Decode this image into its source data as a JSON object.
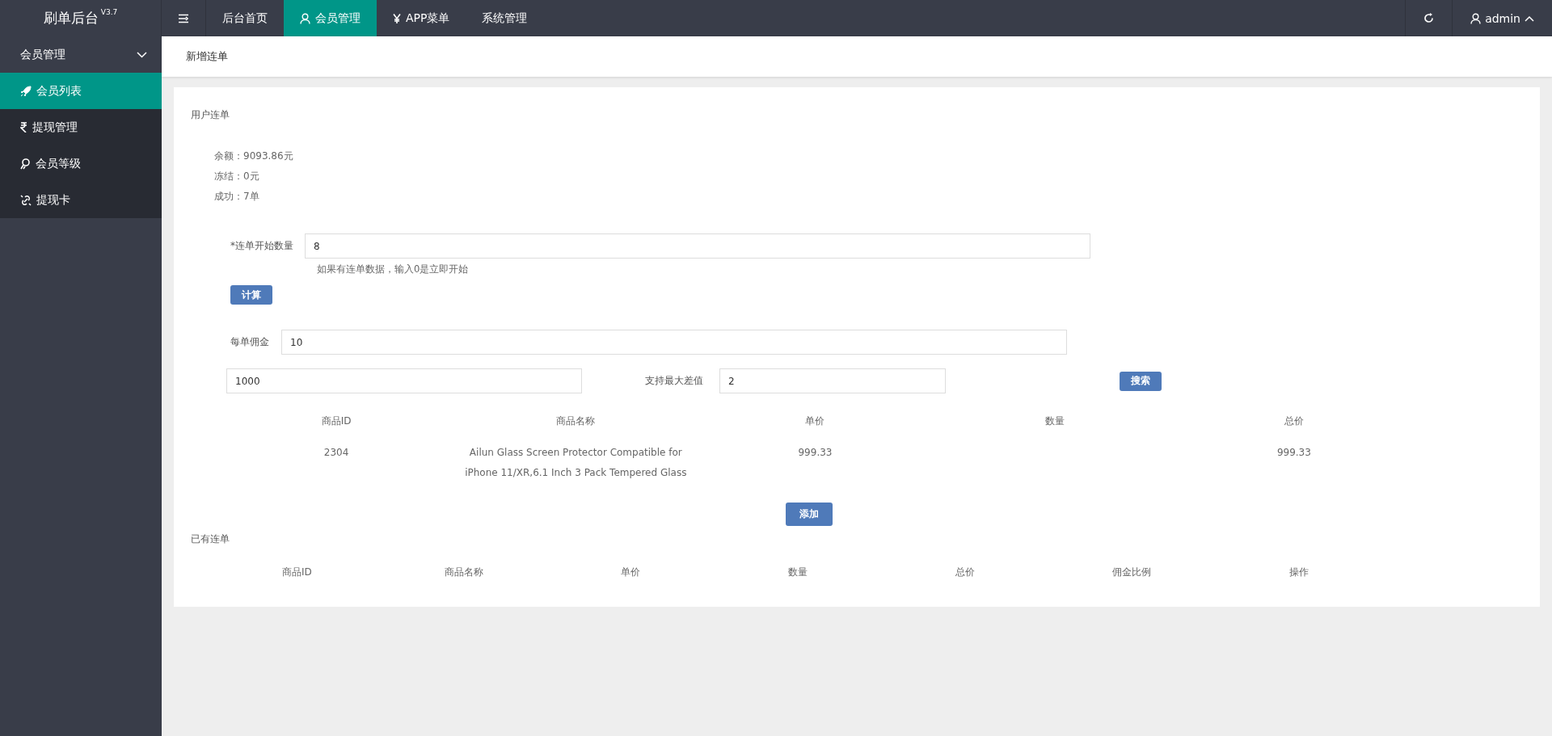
{
  "logo": {
    "title": "刷单后台",
    "version": "V3.7"
  },
  "top_nav": [
    {
      "label": "后台首页",
      "selected": false
    },
    {
      "label": "会员管理",
      "selected": true
    },
    {
      "label": "APP菜单",
      "selected": false
    },
    {
      "label": "系统管理",
      "selected": false
    }
  ],
  "user_menu": {
    "name": "admin"
  },
  "sidebar": {
    "group": {
      "label": "会员管理",
      "expanded": true
    },
    "items": [
      {
        "label": "会员列表",
        "selected": true
      },
      {
        "label": "提现管理",
        "selected": false
      },
      {
        "label": "会员等级",
        "selected": false
      },
      {
        "label": "提现卡",
        "selected": false
      }
    ]
  },
  "breadcrumb": "新增连单",
  "section_title": "用户连单",
  "stats": [
    "余额：9093.86元",
    "冻结：0元",
    "成功：7单"
  ],
  "start_count": {
    "label": "*连单开始数量",
    "value": "8",
    "hint": "如果有连单数据，输入0是立即开始"
  },
  "calc_button": "计算",
  "commission": {
    "label": "每单佣金",
    "value": "10"
  },
  "amount": {
    "value": "1000"
  },
  "max_diff": {
    "label": "支持最大差值",
    "value": "2"
  },
  "search_button": "搜索",
  "products": {
    "columns": [
      "商品ID",
      "商品名称",
      "单价",
      "数量",
      "总价"
    ],
    "rows": [
      [
        "2304",
        "Ailun Glass Screen Protector Compatible for iPhone 11/XR,6.1 Inch 3 Pack Tempered Glass",
        "999.33",
        "",
        "999.33"
      ]
    ]
  },
  "add_button": "添加",
  "existing_title": "已有连单",
  "existing": {
    "columns": [
      "商品ID",
      "商品名称",
      "单价",
      "数量",
      "总价",
      "佣金比例",
      "操作"
    ]
  }
}
